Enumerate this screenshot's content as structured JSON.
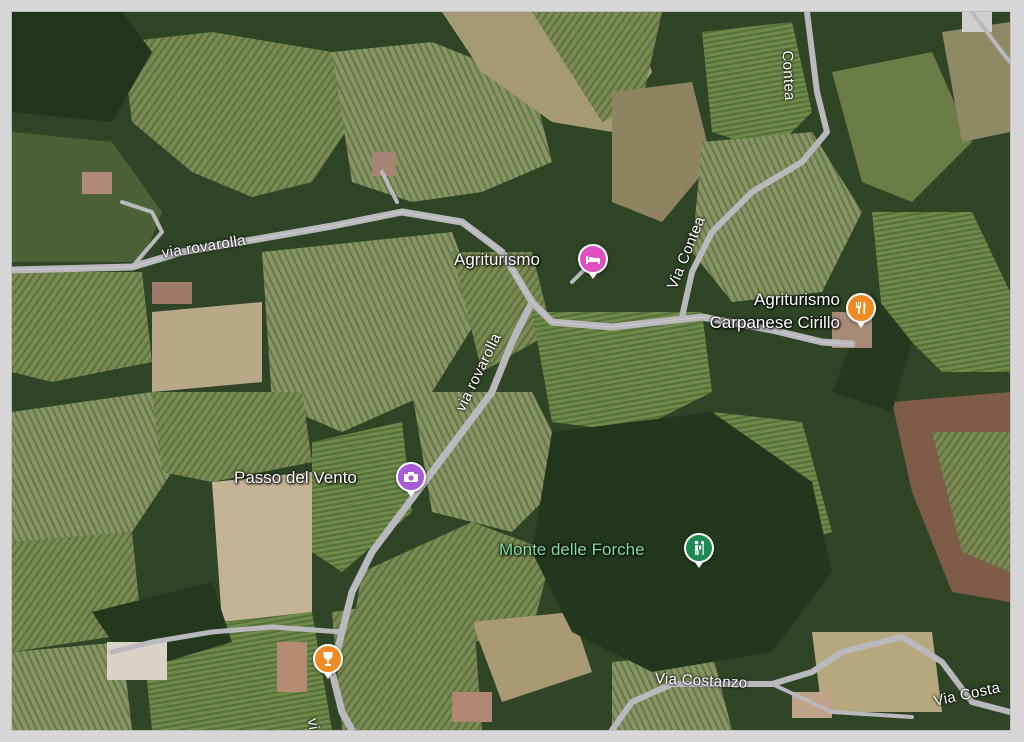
{
  "colors": {
    "lodging": "#e24fc0",
    "food": "#f08a24",
    "photo": "#a95ad7",
    "park": "#1f8a55",
    "road": "#b9b9bd"
  },
  "places": {
    "agriturismo": {
      "label": "Agriturismo",
      "icon": "bed-icon"
    },
    "agriturismo_carpanese": {
      "label_line1": "Agriturismo",
      "label_line2": "Carpanese Cirillo",
      "icon": "fork-knife-icon"
    },
    "passo_del_vento": {
      "label": "Passo del Vento",
      "icon": "camera-icon"
    },
    "monte_delle_forche": {
      "label": "Monte delle Forche",
      "icon": "hiker-icon"
    },
    "wine_bar": {
      "icon": "wine-glass-icon"
    }
  },
  "roads": {
    "via_rovarolla_1": "via rovarolla",
    "via_rovarolla_2": "via rovarolla",
    "via_rovarolla_3": "via r",
    "via_contea_1": "Via Contea",
    "via_contea_2": "Contea",
    "via_costanzo": "Via Costanzo",
    "via_costa": "Via Costa"
  }
}
